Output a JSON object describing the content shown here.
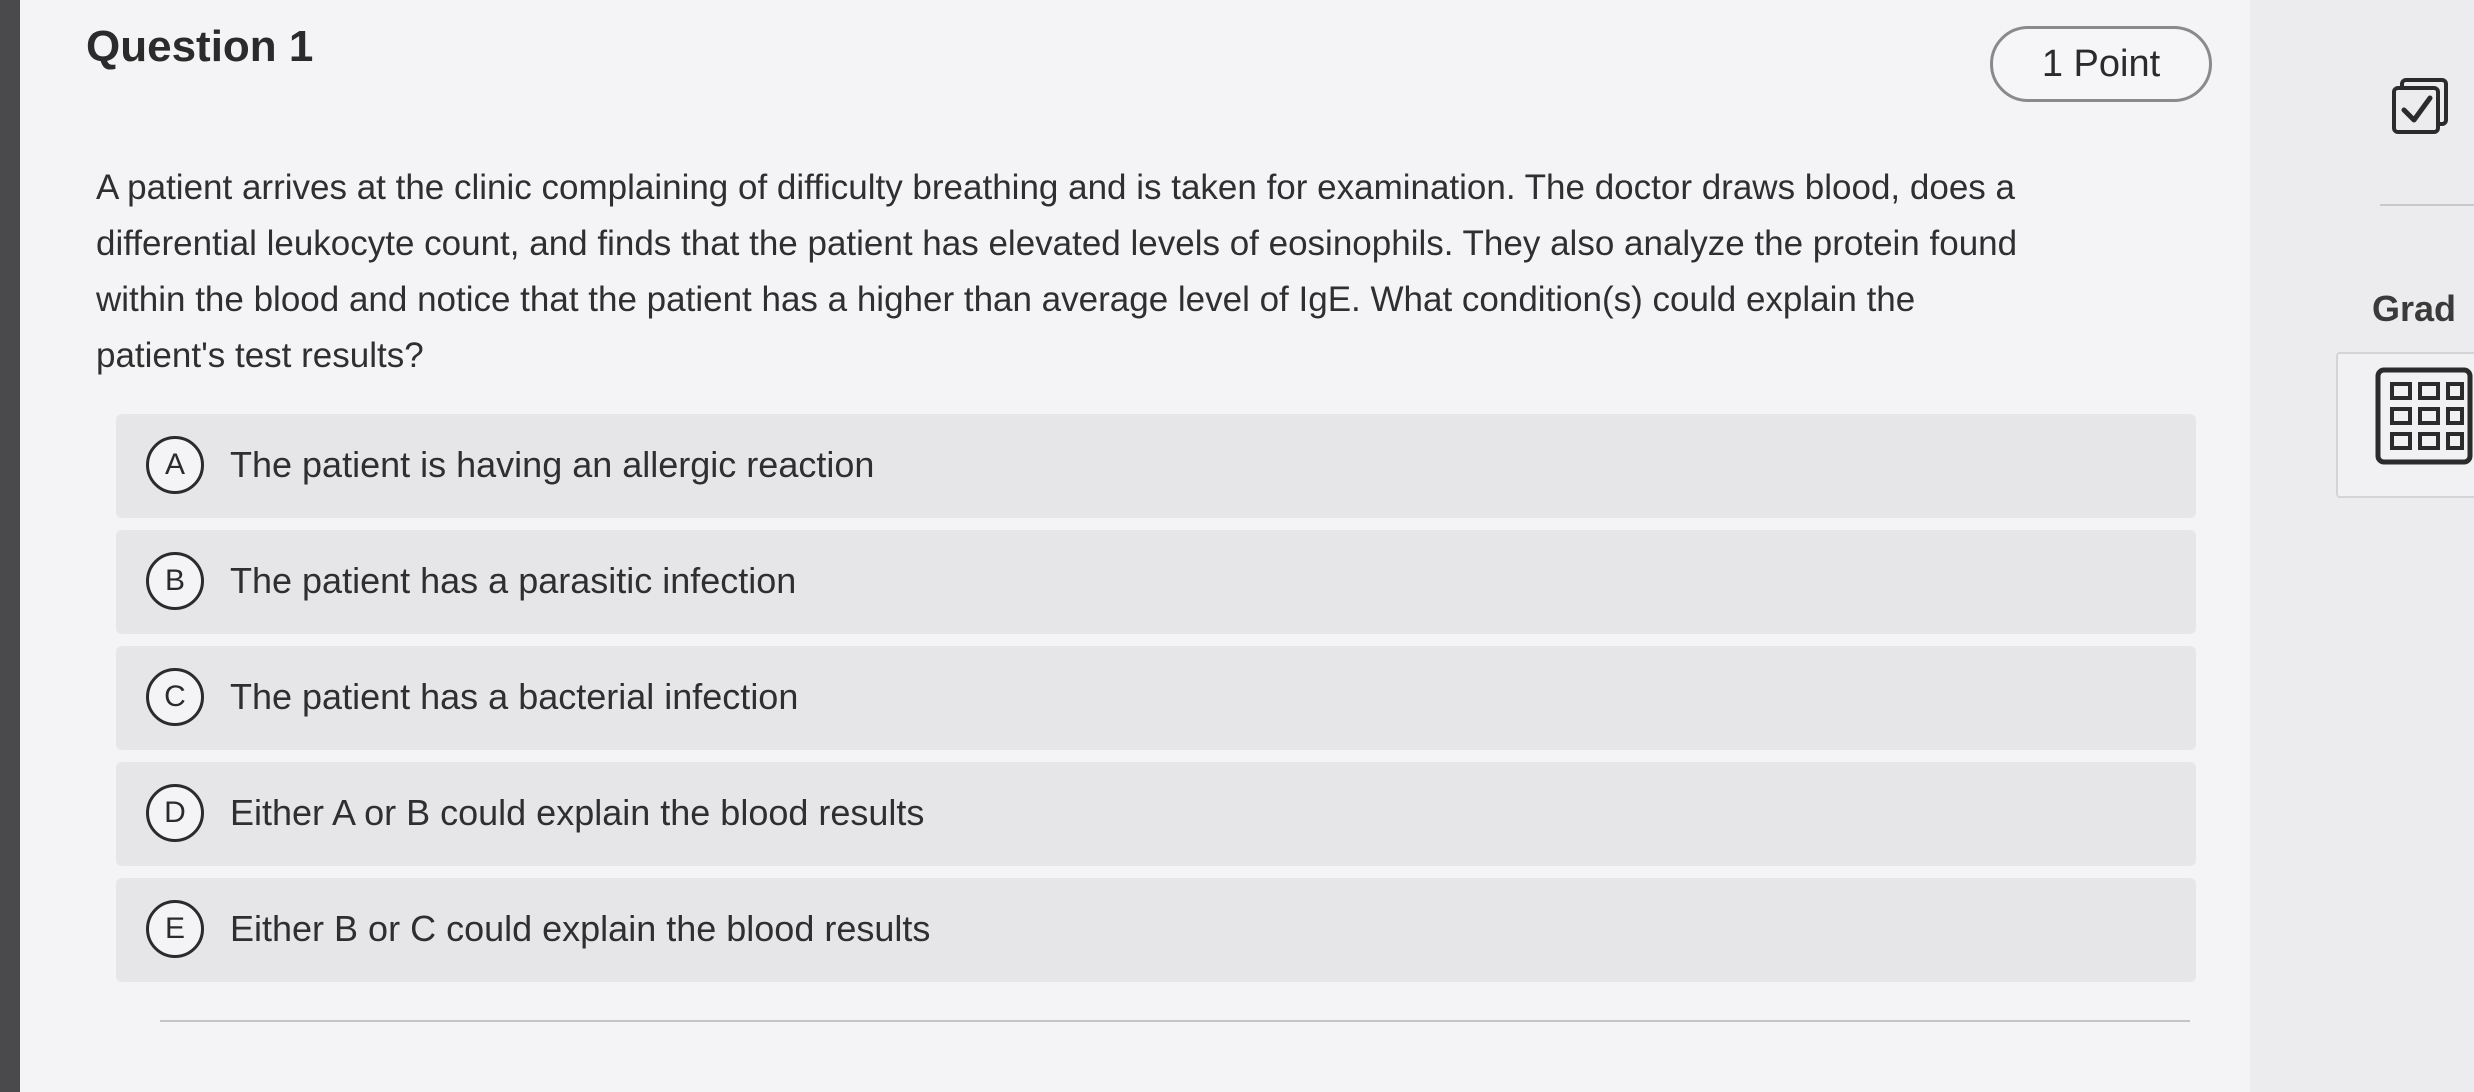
{
  "question": {
    "title": "Question 1",
    "points": "1 Point",
    "prompt_lines": [
      "A patient arrives at the clinic complaining of difficulty breathing and is taken for examination. The doctor draws blood, does a",
      "differential leukocyte count, and finds that the patient has elevated levels of eosinophils. They also analyze the protein found",
      "within the blood and notice that the patient has a higher than average level of IgE. What condition(s) could explain the",
      "patient's test results?"
    ]
  },
  "choices": [
    {
      "letter": "A",
      "text": "The patient is having an allergic reaction"
    },
    {
      "letter": "B",
      "text": "The patient has a parasitic infection"
    },
    {
      "letter": "C",
      "text": "The patient has a bacterial infection"
    },
    {
      "letter": "D",
      "text": "Either A or B could explain the blood results"
    },
    {
      "letter": "E",
      "text": "Either B or C could explain the blood results"
    }
  ],
  "side_panel": {
    "grade_label": "Grad",
    "icons": [
      "checkbox-icon",
      "grid-icon"
    ]
  },
  "colors": {
    "panel_bg": "#f4f4f6",
    "choice_bg": "#e6e6e9",
    "text": "#2f2f2f",
    "border": "#2b2b2b"
  }
}
